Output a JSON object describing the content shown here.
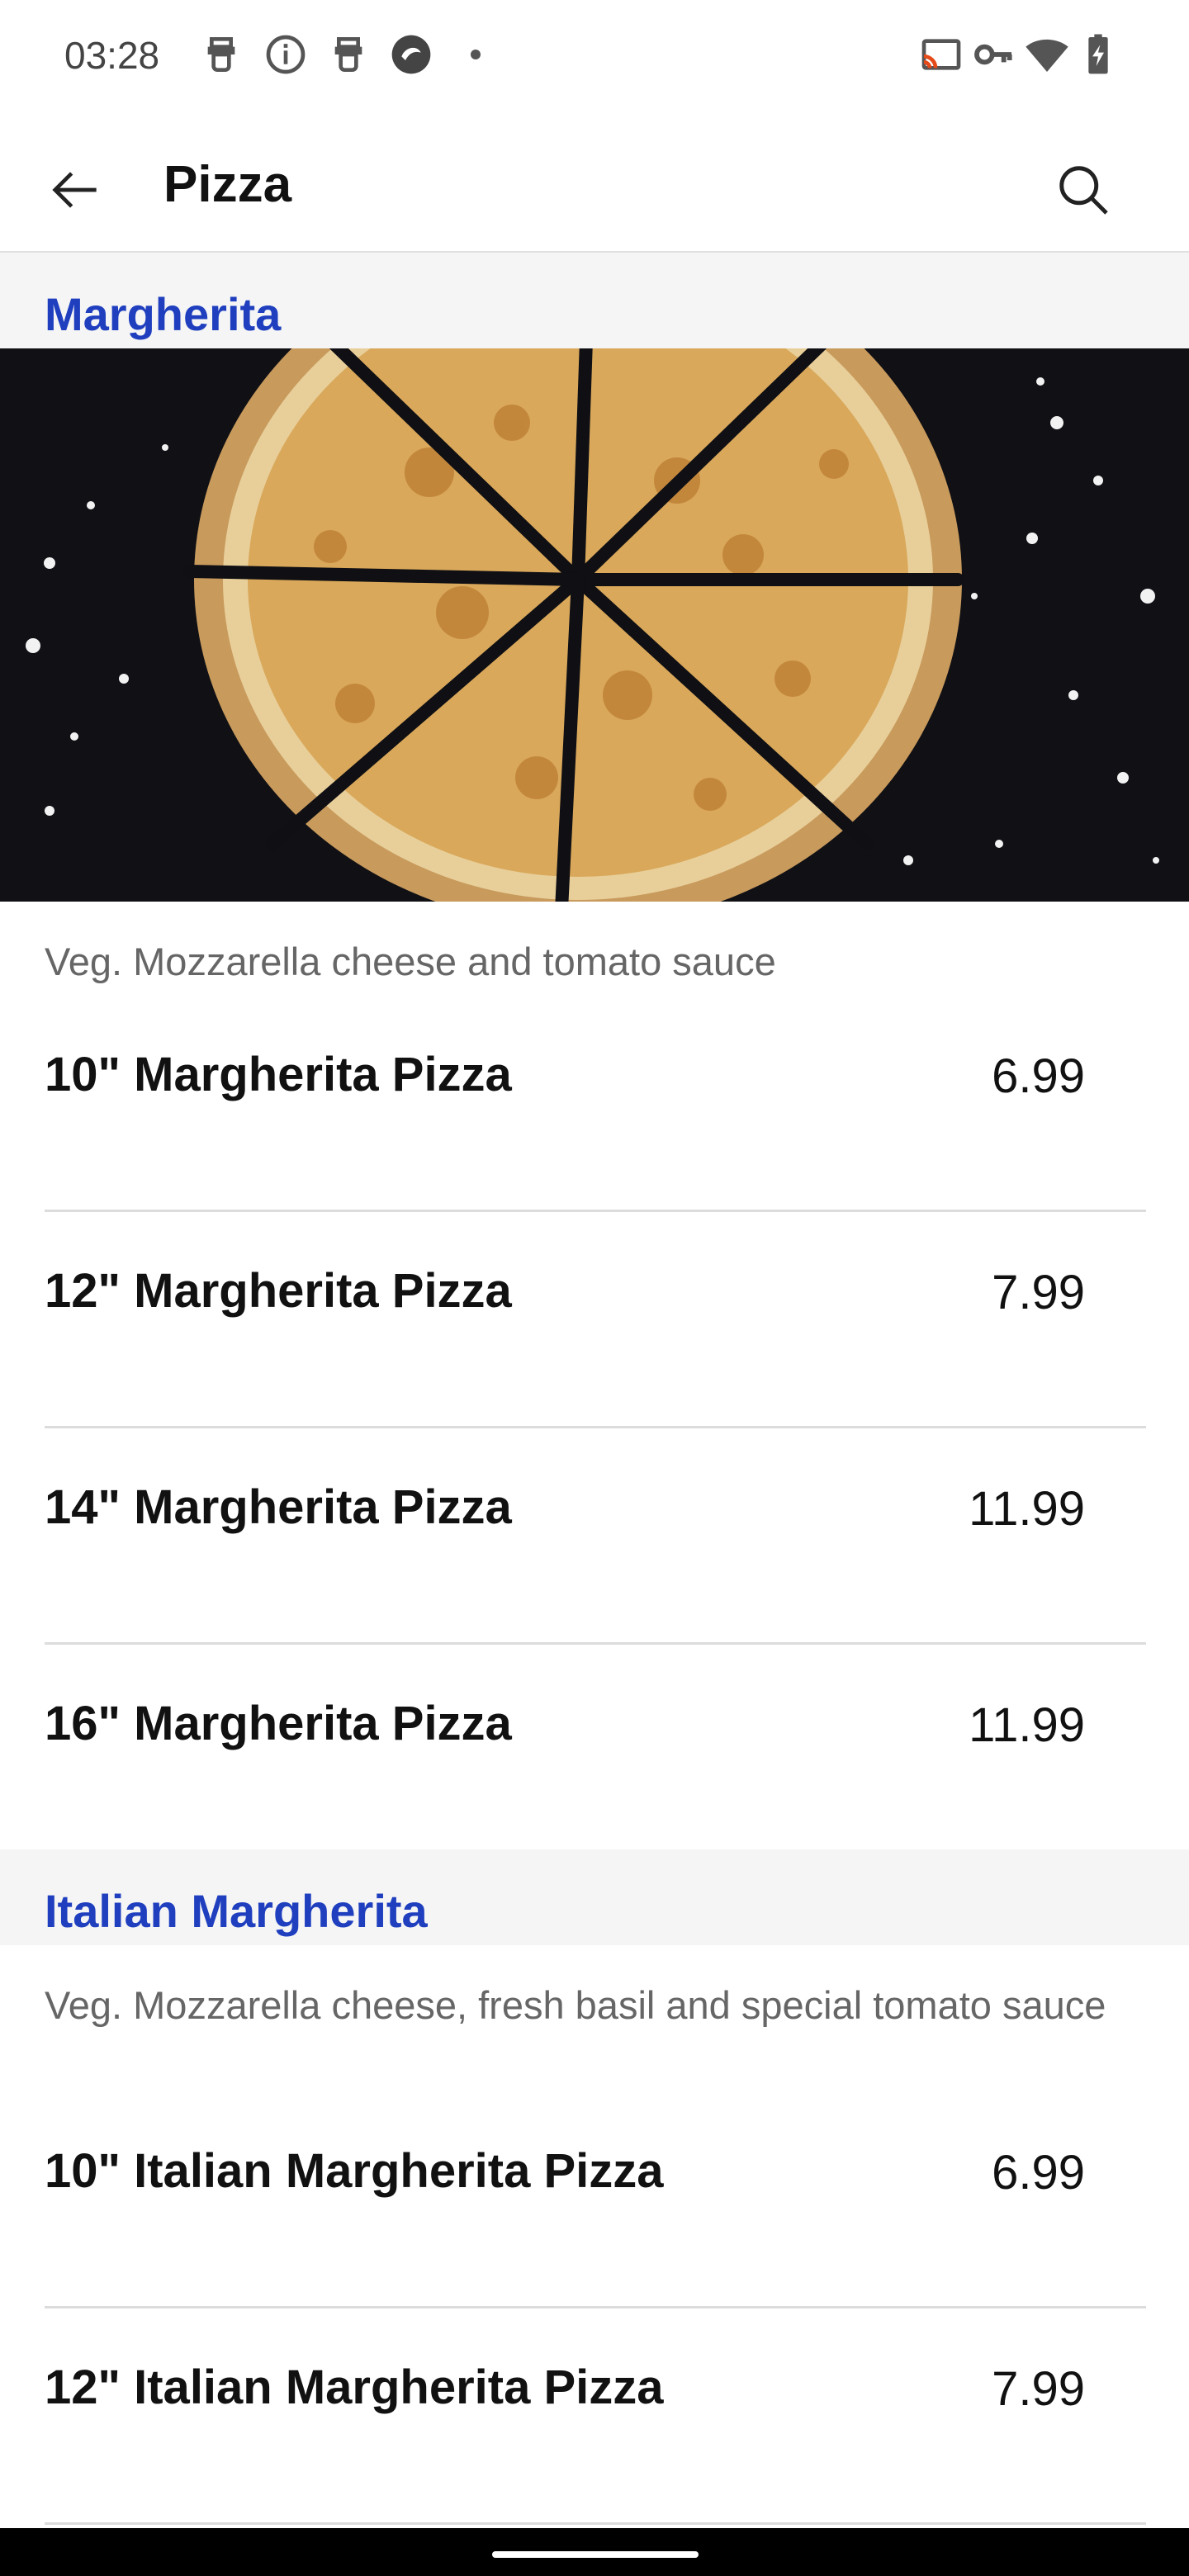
{
  "status_bar": {
    "time": "03:28",
    "left_icons": [
      "notification-app-icon",
      "info-icon",
      "notification-app-icon",
      "app-badge-icon",
      "dot-icon"
    ],
    "right_icons": [
      "cast-icon",
      "vpn-key-icon",
      "wifi-icon",
      "battery-charging-icon"
    ]
  },
  "app_bar": {
    "title": "Pizza",
    "back_icon": "arrow-left-icon",
    "search_icon": "search-icon"
  },
  "accent_color": "#1f3fbf",
  "sections": [
    {
      "title": "Margherita",
      "description": "Veg. Mozzarella cheese and tomato sauce",
      "items": [
        {
          "name": "10\" Margherita Pizza",
          "price": "6.99"
        },
        {
          "name": "12\" Margherita Pizza",
          "price": "7.99"
        },
        {
          "name": "14\" Margherita Pizza",
          "price": "11.99"
        },
        {
          "name": "16\" Margherita Pizza",
          "price": "11.99"
        }
      ]
    },
    {
      "title": "Italian Margherita",
      "description": "Veg. Mozzarella cheese, fresh basil and special tomato sauce",
      "items": [
        {
          "name": "10\" Italian Margherita Pizza",
          "price": "6.99"
        },
        {
          "name": "12\" Italian Margherita Pizza",
          "price": "7.99"
        }
      ]
    }
  ]
}
